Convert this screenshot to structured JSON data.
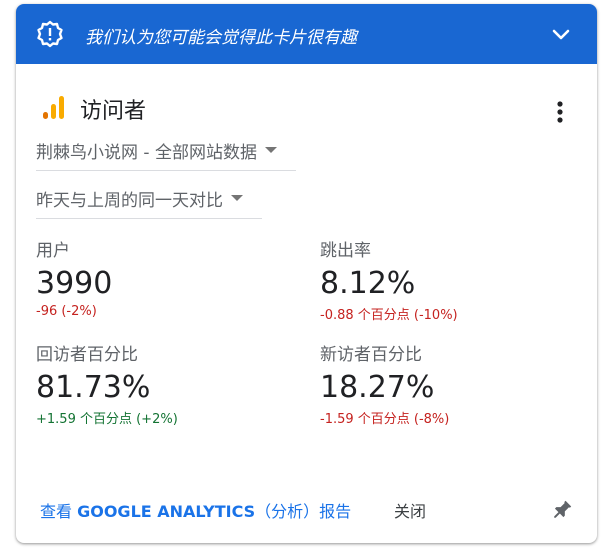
{
  "banner": {
    "text": "我们认为您可能会觉得此卡片很有趣",
    "icon": "gear-alert-icon",
    "expand_icon": "chevron-down-icon",
    "color": "#1967d2"
  },
  "card": {
    "title": "访问者",
    "title_icon": "analytics-bars-icon",
    "menu_icon": "more-vert-icon"
  },
  "selectors": {
    "property": "荆棘鸟小说网 - 全部网站数据",
    "comparison": "昨天与上周的同一天对比"
  },
  "metrics": [
    {
      "label": "用户",
      "value": "3990",
      "delta": "-96 (-2%)",
      "trend": "down"
    },
    {
      "label": "跳出率",
      "value": "8.12%",
      "delta": "-0.88 个百分点 (-10%)",
      "trend": "down"
    },
    {
      "label": "回访者百分比",
      "value": "81.73%",
      "delta": "+1.59 个百分点 (+2%)",
      "trend": "up"
    },
    {
      "label": "新访者百分比",
      "value": "18.27%",
      "delta": "-1.59 个百分点 (-8%)",
      "trend": "down"
    }
  ],
  "footer": {
    "link_prefix": "查看 ",
    "link_strong": "GOOGLE ANALYTICS",
    "link_suffix": "（分析）报告",
    "close_label": "关闭",
    "pin_icon": "pin-icon"
  },
  "colors": {
    "negative": "#c5221f",
    "positive": "#137333",
    "link": "#1a73e8",
    "analytics_orange": "#f9ab00",
    "analytics_dark_orange": "#e37400"
  }
}
